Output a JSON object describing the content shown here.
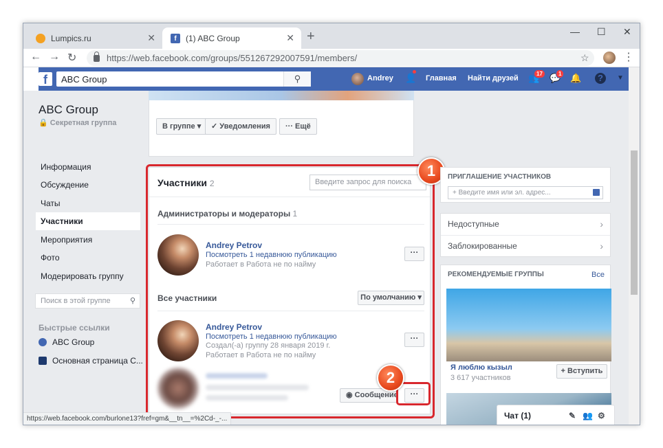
{
  "browser": {
    "tabs": [
      {
        "title": "Lumpics.ru",
        "favicon_color": "#f4a122"
      },
      {
        "title": "(1) ABC Group",
        "favicon_color": "#4267b2",
        "favicon_glyph": "f"
      }
    ],
    "url": "https://web.facebook.com/groups/551267292007591/members/",
    "new_tab": "+",
    "minimize": "—",
    "maximize": "☐",
    "close": "✕",
    "back": "←",
    "forward": "→",
    "reload": "↻",
    "bookmark": "☆",
    "menu": "⋮",
    "status_url": "https://web.facebook.com/burlone13?fref=gm&__tn__=%2Cd-_-..."
  },
  "fb": {
    "logo": "f",
    "search_value": "ABC Group",
    "search_icon": "⚲",
    "user_name": "Andrey",
    "nav_home": "Главная",
    "nav_find_friends": "Найти друзей",
    "badge_friends": "17",
    "badge_messages": "1",
    "friends_icon": "👥",
    "messenger_icon": "💬",
    "bell_icon": "🔔",
    "help_icon": "?",
    "caret_icon": "▼",
    "group_req_icon": "👤"
  },
  "left": {
    "group_name": "ABC Group",
    "group_type": "Секретная группа",
    "menu": [
      "Информация",
      "Обсуждение",
      "Чаты",
      "Участники",
      "Мероприятия",
      "Фото",
      "Модерировать группу"
    ],
    "search_placeholder": "Поиск в этой группе",
    "quick_links_title": "Быстрые ссылки",
    "quick_links": [
      "ABC Group",
      "Основная страница С..."
    ]
  },
  "group_bar": {
    "in_group": "В группе ▾",
    "notifications": "✓ Уведомления",
    "more": "··· Ещё"
  },
  "members": {
    "title": "Участники",
    "count": "2",
    "search_placeholder": "Введите запрос для поиска",
    "admins_title": "Администраторы и модераторы",
    "admins_count": "1",
    "all_title": "Все участники",
    "sort_label": "По умолчанию ▾",
    "dots": "···",
    "message_btn": "Сообщение",
    "admin": {
      "name": "Andrey Petrov",
      "link": "Посмотреть 1 недавнюю публикацию",
      "work": "Работает в Работа не по найму"
    },
    "member": {
      "name": "Andrey Petrov",
      "link": "Посмотреть 1 недавнюю публикацию",
      "created": "Создал(-а) группу 28 января 2019 г.",
      "work": "Работает в Работа не по найму"
    }
  },
  "callouts": [
    "1",
    "2"
  ],
  "right": {
    "invite_title": "ПРИГЛАШЕНИЕ УЧАСТНИКОВ",
    "invite_placeholder": "+ Введите имя или эл. адрес...",
    "unavailable": "Недоступные",
    "blocked": "Заблокированные",
    "rec_title": "РЕКОМЕНДУЕМЫЕ ГРУППЫ",
    "rec_all": "Все",
    "rec_group_name": "Я люблю кызыл",
    "rec_group_members": "3 617 участников",
    "join_label": "+ Вступить",
    "chevron": "›"
  },
  "chat": {
    "label": "Чат (1)",
    "icons": [
      "✎",
      "👥",
      "⚙"
    ]
  },
  "colors": {
    "fb_blue": "#4267b2",
    "link_blue": "#365899",
    "highlight_red": "#d8272d",
    "callout_orange": "#e8491e"
  }
}
